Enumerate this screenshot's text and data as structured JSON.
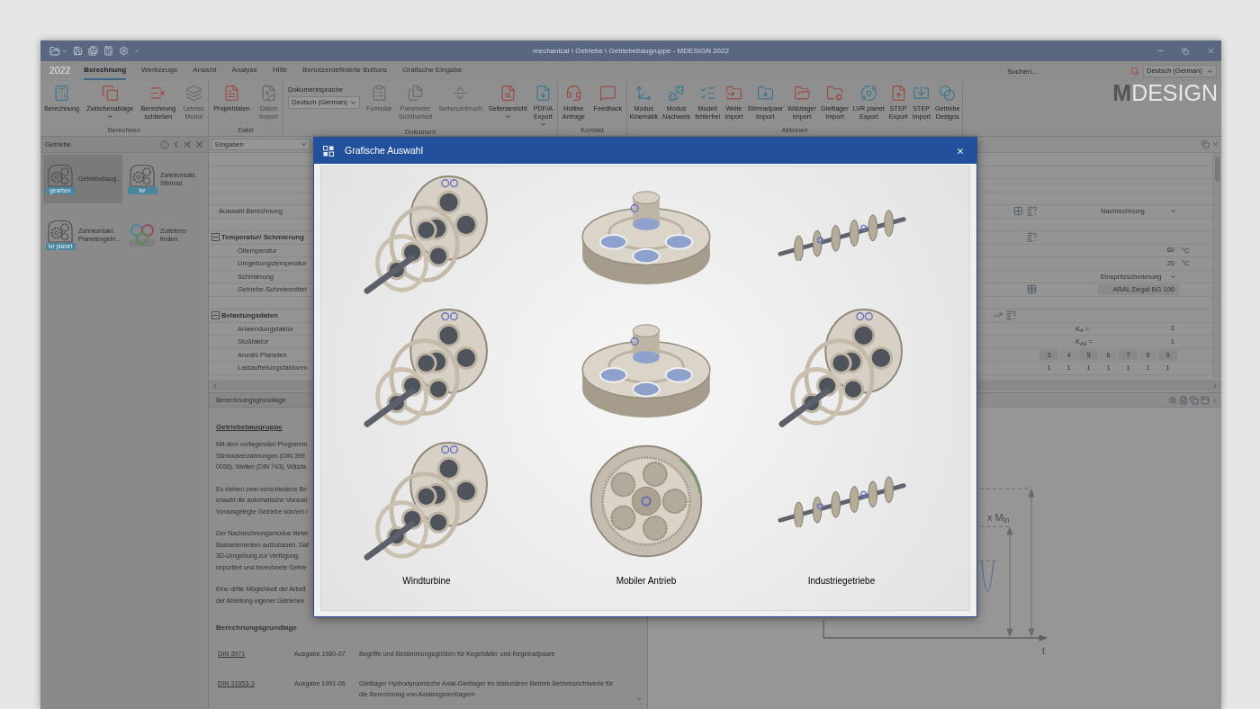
{
  "window": {
    "title": "mechanical \\ Getriebe \\ Getriebebaugruppe - MDESIGN 2022"
  },
  "menu": {
    "app_label": "2022",
    "tabs": [
      {
        "label": "Berechnung",
        "selected": true
      },
      {
        "label": "Werkzeuge",
        "selected": false
      },
      {
        "label": "Ansicht",
        "selected": false
      },
      {
        "label": "Analyse",
        "selected": false
      },
      {
        "label": "Hilfe",
        "selected": false
      },
      {
        "label": "Benutzerdefinierte Buttons",
        "selected": false
      },
      {
        "label": "Grafische Eingabe",
        "selected": false
      }
    ],
    "search": {
      "placeholder": "Suchen..."
    },
    "language": "Deutsch (German)",
    "logo": "**M**DESIGN"
  },
  "ribbon": {
    "groups": [
      {
        "label": "Berechnen",
        "items": [
          {
            "kind": "button",
            "label": "Berechnung",
            "disabled": false,
            "has_menu": false
          },
          {
            "kind": "button",
            "label": "Zwischenablage",
            "disabled": false,
            "has_menu": true
          },
          {
            "kind": "button",
            "label": "Berechnung\nschließen",
            "disabled": false,
            "has_menu": false
          },
          {
            "kind": "button",
            "label": "Letztes\nModul",
            "disabled": true,
            "has_menu": false
          }
        ]
      },
      {
        "label": "Datei",
        "items": [
          {
            "kind": "button",
            "label": "Projektdaten",
            "disabled": false,
            "has_menu": false
          },
          {
            "kind": "button",
            "label": "Daten\nImport",
            "disabled": true,
            "has_menu": false
          }
        ]
      },
      {
        "label": "Dokument",
        "items": [
          {
            "kind": "select",
            "label": "Dokumentsprache",
            "value": "Deutsch (German)",
            "disabled": false,
            "has_menu": true
          },
          {
            "kind": "button",
            "label": "Formular",
            "disabled": true,
            "has_menu": false
          },
          {
            "kind": "button",
            "label": "Parameter\nSichtbarkeit",
            "disabled": true,
            "has_menu": false
          },
          {
            "kind": "button",
            "label": "Seitenumbruch",
            "disabled": true,
            "has_menu": false
          },
          {
            "kind": "button",
            "label": "Seitenansicht",
            "disabled": false,
            "has_menu": true
          },
          {
            "kind": "button",
            "label": "PDF/A\nExport",
            "disabled": false,
            "has_menu": true
          }
        ]
      },
      {
        "label": "Kontakt",
        "items": [
          {
            "kind": "button",
            "label": "Hotline\nAnfrage",
            "disabled": false,
            "has_menu": false
          },
          {
            "kind": "button",
            "label": "Feedback",
            "disabled": false,
            "has_menu": false
          }
        ]
      },
      {
        "label": "Aktionen",
        "items": [
          {
            "kind": "button",
            "label": "Modus\nKinematik",
            "disabled": false,
            "has_menu": false
          },
          {
            "kind": "button",
            "label": "Modus\nNachweis",
            "disabled": false,
            "has_menu": false
          },
          {
            "kind": "button",
            "label": "Modell\nfehlerfrei",
            "disabled": false,
            "has_menu": false
          },
          {
            "kind": "button",
            "label": "Welle\nImport",
            "disabled": false,
            "has_menu": false
          },
          {
            "kind": "button",
            "label": "Stirnradpaar\nImport",
            "disabled": false,
            "has_menu": false
          },
          {
            "kind": "button",
            "label": "Wälzlager\nImport",
            "disabled": false,
            "has_menu": false
          },
          {
            "kind": "button",
            "label": "Gleitlager\nImport",
            "disabled": false,
            "has_menu": false
          },
          {
            "kind": "button",
            "label": "LVR planet\nExport",
            "disabled": false,
            "has_menu": false
          },
          {
            "kind": "button",
            "label": "STEP\nExport",
            "disabled": false,
            "has_menu": false
          },
          {
            "kind": "button",
            "label": "STEP\nImport",
            "disabled": false,
            "has_menu": false
          },
          {
            "kind": "button",
            "label": "Getriebe\nDesigns",
            "disabled": false,
            "has_menu": false
          }
        ]
      }
    ]
  },
  "sidebar": {
    "title": "Getriebe",
    "items": [
      {
        "label": "Getriebebaug...",
        "badge": "gearbox",
        "selected": true
      },
      {
        "label": "Zahnkontakt.\nStirnrad",
        "badge": "lvr",
        "selected": false
      },
      {
        "label": "Zahnkontakt.\nPlanetengetri...",
        "badge": "lvr planet",
        "selected": false
      },
      {
        "label": "Zulieferer\nfinden",
        "selected": false
      }
    ]
  },
  "inputs": {
    "header": "Eingaben",
    "rows": [
      {
        "kind": "blank"
      },
      {
        "kind": "blank"
      },
      {
        "kind": "blank"
      },
      {
        "kind": "blank"
      },
      {
        "kind": "select",
        "label": "Auswahl Berechnung",
        "value": "Nachrechnung"
      },
      {
        "kind": "blank"
      },
      {
        "kind": "section",
        "label": "Temperatur/ Schmierung",
        "expanded": true,
        "children": [
          {
            "kind": "number",
            "label": "Öltemperatur",
            "value": "60",
            "unit": "°C"
          },
          {
            "kind": "number",
            "label": "Umgebungstemperatur",
            "value": "20",
            "unit": "°C"
          },
          {
            "kind": "select",
            "label": "Schmierung",
            "value": "Einspritzschmierung"
          },
          {
            "kind": "lookup",
            "label": "Getriebe-Schmiermittel",
            "value": "ARAL Degol BG 100"
          }
        ]
      },
      {
        "kind": "blank"
      },
      {
        "kind": "section",
        "label": "Belastungsdaten",
        "expanded": true,
        "children": [
          {
            "kind": "factor",
            "label": "Anwendungsfaktor",
            "symbol": "K$_{A}$ =",
            "value": "1"
          },
          {
            "kind": "factor",
            "label": "Stoßfaktor",
            "symbol": "K$_{AS}$ =",
            "value": "1"
          },
          {
            "kind": "cells",
            "label": "Anzahl Planeten",
            "header": true,
            "cells": [
              "3",
              "4",
              "5",
              "6",
              "7",
              "8",
              "9"
            ]
          },
          {
            "kind": "cells",
            "label": "Lastaufteilungsfaktoren",
            "header": false,
            "cells": [
              "1",
              "1",
              "1",
              "1",
              "1",
              "1",
              "1"
            ]
          }
        ]
      }
    ]
  },
  "document": {
    "header": "Berechnungsgrundlage",
    "title": "Getriebebaugruppe",
    "paragraphs": [
      "Mit dem vorliegenden Programm\nStirnradverzahnungen (DIN 399\n0036), Wellen (DIN 743), Wälzla",
      "Es stehen zwei verschiedene Be\nerlaubt die automatische Vorausl\nVorausgelegte Getriebe können i",
      "Der Nachrechnungsmodus bietet\nBasiselementen aufzubauen. Daf\n3D-Umgebung zur Verfügung.\nimportiert und berechnete Getrie",
      "Eine dritte Möglichkeit der Arbeit\nder Ableitung eigener Getriebek"
    ],
    "section": "Berechnungsgrundlage",
    "standards": [
      {
        "code": "DIN 3971",
        "edition": "Ausgabe 1980-07",
        "description": "Begriffe und Bestimmungsgrößen für Kegelräder und Kegelradpaare"
      },
      {
        "code": "DIN 31653-3",
        "edition": "Ausgabe 1991-06",
        "description": "Gleitlager Hydrodynamische Axial-Gleitlager im stationären Betrieb Betriebsrichtwerte für\ndie Berechnung von Axialsegmentlagern"
      }
    ]
  },
  "chart_panel": {
    "label": "x M$_{tn}$",
    "axis_label": "t"
  },
  "dialog": {
    "title": "Grafische Auswahl",
    "columns": [
      {
        "label": "Windturbine"
      },
      {
        "label": "Mobiler Antrieb"
      },
      {
        "label": "Industriegetriebe"
      }
    ]
  }
}
